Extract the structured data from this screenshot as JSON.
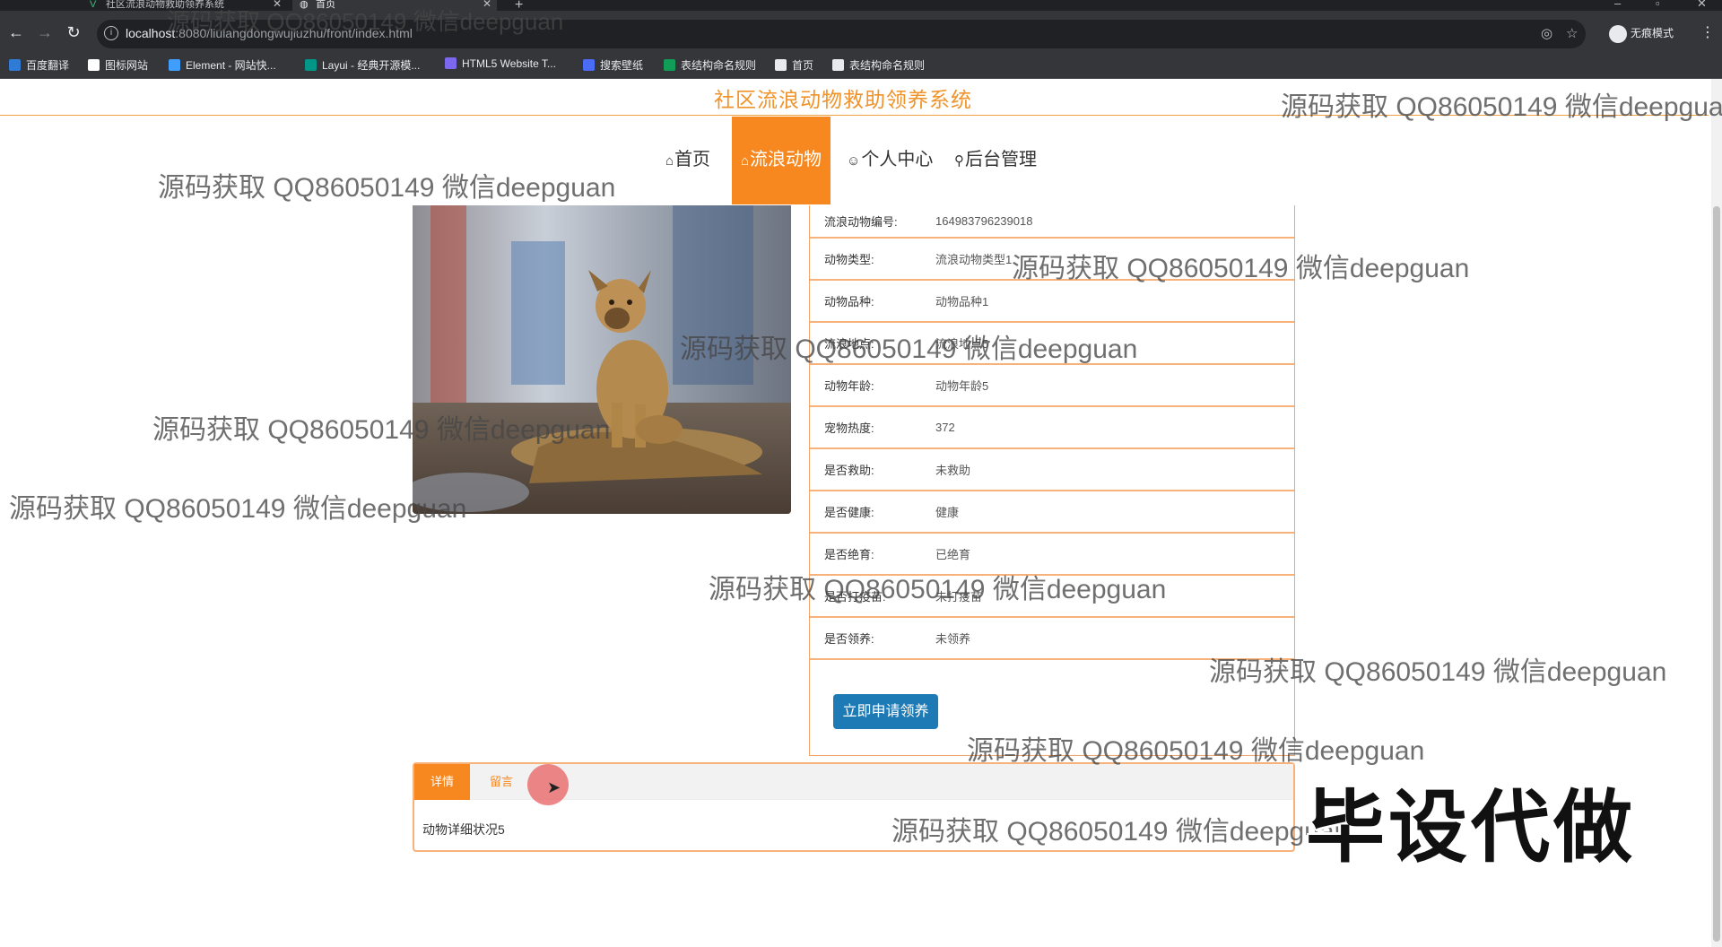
{
  "browser": {
    "tabs": [
      {
        "title": "社区流浪动物救助领养系统",
        "active": false
      },
      {
        "title": "首页",
        "active": true
      }
    ],
    "url_host": "localhost",
    "url_rest": ":8080/liulangdongwujiuzhu/front/index.html",
    "incognito_label": "无痕模式",
    "bookmarks": [
      {
        "label": "百度翻译",
        "color": "#2f7bd6"
      },
      {
        "label": "图标网站",
        "color": "#ffffff"
      },
      {
        "label": "Element - 网站快...",
        "color": "#409eff"
      },
      {
        "label": "Layui - 经典开源模...",
        "color": "#009688"
      },
      {
        "label": "HTML5 Website T...",
        "color": "#7b68ee"
      },
      {
        "label": "搜索壁纸",
        "color": "#4a6cf7"
      },
      {
        "label": "表结构命名规则",
        "color": "#0f9d58"
      },
      {
        "label": "首页",
        "color": "#e8eaed"
      },
      {
        "label": "表结构命名规则",
        "color": "#e8eaed"
      }
    ]
  },
  "site": {
    "title": "社区流浪动物救助领养系统",
    "nav": [
      {
        "icon": "⌂",
        "label": "首页",
        "active": false
      },
      {
        "icon": "⌂",
        "label": "流浪动物",
        "active": true
      },
      {
        "icon": "☺",
        "label": "个人中心",
        "active": false
      },
      {
        "icon": "⚲",
        "label": "后台管理",
        "active": false
      }
    ]
  },
  "detail": {
    "rows": [
      {
        "label": "流浪动物编号:",
        "value": "164983796239018"
      },
      {
        "label": "动物类型:",
        "value": "流浪动物类型1"
      },
      {
        "label": "动物品种:",
        "value": "动物品种1"
      },
      {
        "label": "流浪地点:",
        "value": "流浪地点5"
      },
      {
        "label": "动物年龄:",
        "value": "动物年龄5"
      },
      {
        "label": "宠物热度:",
        "value": "372"
      },
      {
        "label": "是否救助:",
        "value": "未救助"
      },
      {
        "label": "是否健康:",
        "value": "健康"
      },
      {
        "label": "是否绝育:",
        "value": "已绝育"
      },
      {
        "label": "是否打疫苗:",
        "value": "未打疫苗"
      },
      {
        "label": "是否领养:",
        "value": "未领养"
      }
    ],
    "adopt_button": "立即申请领养"
  },
  "tabs": {
    "items": [
      "详情",
      "留言"
    ],
    "content": "动物详细状况5"
  },
  "overlay": {
    "watermark": "源码获取 QQ86050149 微信deepguan",
    "stamp": "毕设代做"
  },
  "colors": {
    "accent": "#f7881f",
    "title": "#f0932b",
    "button": "#1e7ab5"
  }
}
